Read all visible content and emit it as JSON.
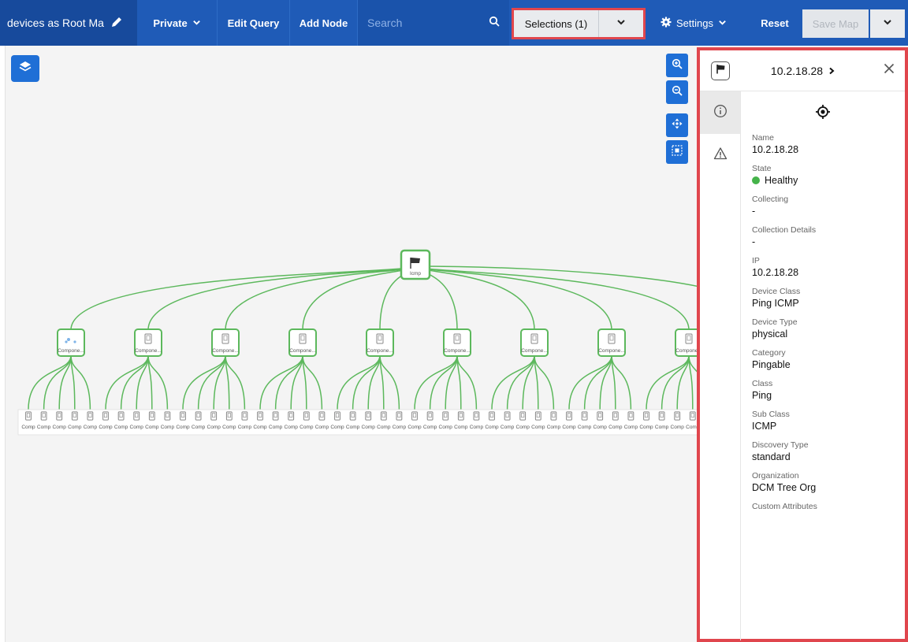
{
  "toolbar": {
    "map_title": "devices as Root Ma",
    "visibility_label": "Private",
    "edit_query_label": "Edit Query",
    "add_node_label": "Add Node",
    "search_placeholder": "Search",
    "selections_label": "Selections (1)",
    "settings_label": "Settings",
    "reset_label": "Reset",
    "save_map_label": "Save Map"
  },
  "graph": {
    "root_label": "Icmp",
    "component_label": "Compone...",
    "leaf_label": "Comp",
    "component_count": 9,
    "leaf_count": 45
  },
  "panel": {
    "title": "10.2.18.28",
    "fields": [
      {
        "label": "Name",
        "value": "10.2.18.28"
      },
      {
        "label": "State",
        "value": "Healthy",
        "status_color": "#45b34a"
      },
      {
        "label": "Collecting",
        "value": "-"
      },
      {
        "label": "Collection Details",
        "value": "-"
      },
      {
        "label": "IP",
        "value": "10.2.18.28"
      },
      {
        "label": "Device Class",
        "value": "Ping ICMP"
      },
      {
        "label": "Device Type",
        "value": "physical"
      },
      {
        "label": "Category",
        "value": "Pingable"
      },
      {
        "label": "Class",
        "value": "Ping"
      },
      {
        "label": "Sub Class",
        "value": "ICMP"
      },
      {
        "label": "Discovery Type",
        "value": "standard"
      },
      {
        "label": "Organization",
        "value": "DCM Tree Org"
      },
      {
        "label": "Custom Attributes",
        "value": ""
      }
    ]
  },
  "colors": {
    "topbar": "#1f5bb7",
    "accent": "#1f6fd6",
    "edge": "#5cb85c",
    "highlight": "#e0464d"
  }
}
